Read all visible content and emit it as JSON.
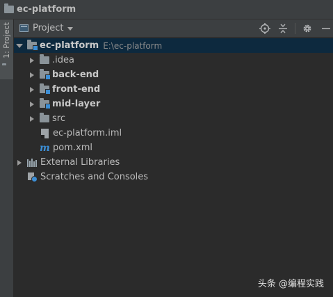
{
  "window": {
    "title": "ec-platform"
  },
  "side_tab": {
    "label": "1: Project"
  },
  "panel": {
    "view_selector": "Project",
    "tools": [
      "locate-icon",
      "collapse-icon",
      "gear-icon",
      "hide-icon"
    ]
  },
  "tree": {
    "root": {
      "name": "ec-platform",
      "path": "E:\\ec-platform"
    },
    "children": [
      {
        "name": ".idea",
        "type": "folder"
      },
      {
        "name": "back-end",
        "type": "module"
      },
      {
        "name": "front-end",
        "type": "module"
      },
      {
        "name": "mid-layer",
        "type": "module"
      },
      {
        "name": "src",
        "type": "folder"
      },
      {
        "name": "ec-platform.iml",
        "type": "iml-file"
      },
      {
        "name": "pom.xml",
        "type": "maven-file"
      }
    ],
    "external_libraries": "External Libraries",
    "scratches": "Scratches and Consoles"
  },
  "watermark": "头条 @编程实践",
  "colors": {
    "background": "#2b2b2b",
    "toolbar": "#3c3f41",
    "selection": "#0d293e",
    "module_badge": "#3c8ed5"
  }
}
